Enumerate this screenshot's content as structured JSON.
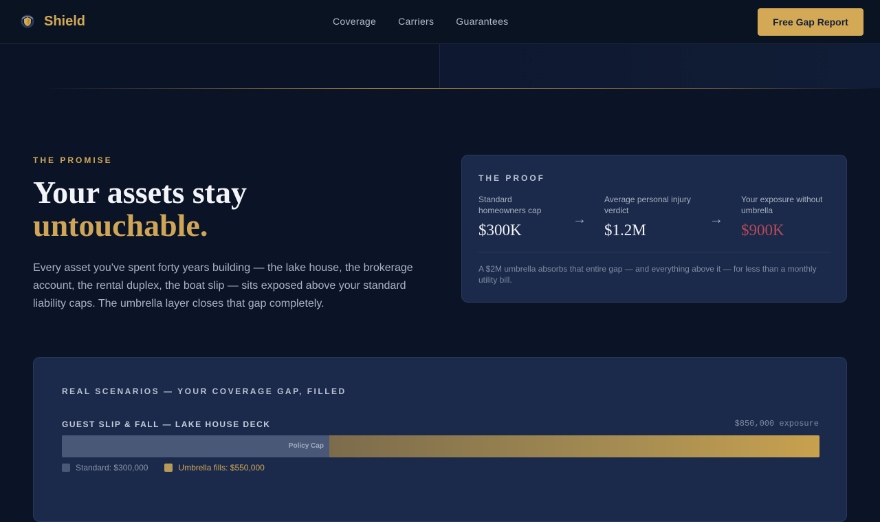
{
  "nav": {
    "brand": "Shield",
    "links": [
      "Coverage",
      "Carriers",
      "Guarantees"
    ],
    "cta": "Free Gap Report"
  },
  "promise": {
    "eyebrow": "THE PROMISE",
    "headline_line1": "Your assets stay",
    "headline_line2": "untouchable.",
    "body": "Every asset you've spent forty years building — the lake house, the brokerage account, the rental duplex, the boat slip — sits exposed above your standard liability caps. The umbrella layer closes that gap completely."
  },
  "proof": {
    "title": "THE PROOF",
    "items": [
      {
        "label": "Standard homeowners cap",
        "value": "$300K"
      },
      {
        "label": "Average personal injury verdict",
        "value": "$1.2M"
      },
      {
        "label": "Your exposure without umbrella",
        "value": "$900K"
      }
    ],
    "arrow": "→",
    "footnote": "A $2M umbrella absorbs that entire gap — and everything above it — for less than a monthly utility bill."
  },
  "scenarios": {
    "heading": "REAL SCENARIOS — YOUR COVERAGE GAP, FILLED",
    "items": [
      {
        "title": "GUEST SLIP & FALL — LAKE HOUSE DECK",
        "exposure": "$850,000 exposure",
        "cap_label": "Policy Cap",
        "standard_amount": 300000,
        "umbrella_amount": 550000,
        "legend_standard": "Standard: $300,000",
        "legend_umbrella": "Umbrella fills: $550,000"
      }
    ]
  },
  "colors": {
    "accent_gold": "#d4a955",
    "danger_red": "#b84a57",
    "background": "#0b1426",
    "card": "#1b2a4a"
  }
}
